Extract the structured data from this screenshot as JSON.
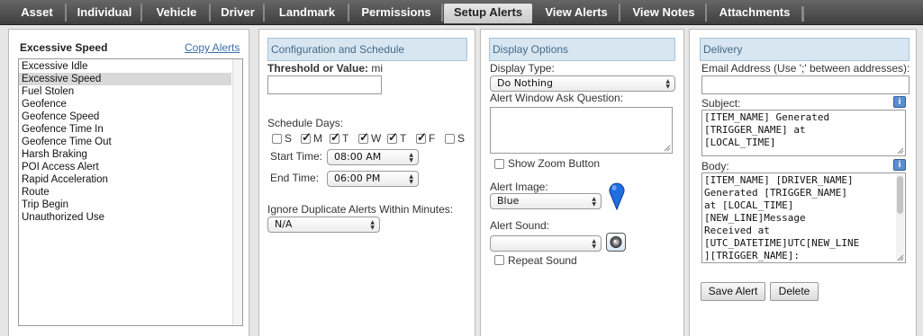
{
  "tabs": [
    {
      "label": "Asset"
    },
    {
      "label": "Individual"
    },
    {
      "label": "Vehicle"
    },
    {
      "label": "Driver"
    },
    {
      "label": "Landmark"
    },
    {
      "label": "Permissions"
    },
    {
      "label": "Setup Alerts"
    },
    {
      "label": "View Alerts"
    },
    {
      "label": "View Notes"
    },
    {
      "label": "Attachments"
    }
  ],
  "alerts_panel": {
    "title": "Excessive Speed",
    "copy_link": "Copy Alerts",
    "items": [
      "Excessive Idle",
      "Excessive Speed",
      "Fuel Stolen",
      "Geofence",
      "Geofence Speed",
      "Geofence Time In",
      "Geofence Time Out",
      "Harsh Braking",
      "POI Access Alert",
      "Rapid Acceleration",
      "Route",
      "Trip Begin",
      "Unauthorized Use"
    ],
    "selected_index": 1
  },
  "config": {
    "header": "Configuration and Schedule",
    "threshold_label": "Threshold or Value:",
    "threshold_unit": "mi",
    "threshold_value": "",
    "schedule_label": "Schedule Days:",
    "days": [
      {
        "letter": "S",
        "checked": false
      },
      {
        "letter": "M",
        "checked": true
      },
      {
        "letter": "T",
        "checked": true
      },
      {
        "letter": "W",
        "checked": true
      },
      {
        "letter": "T",
        "checked": true
      },
      {
        "letter": "F",
        "checked": true
      },
      {
        "letter": "S",
        "checked": false
      }
    ],
    "start_label": "Start Time:",
    "start_value": "08:00 AM",
    "end_label": "End Time:",
    "end_value": "06:00 PM",
    "ignore_label": "Ignore Duplicate Alerts Within Minutes:",
    "ignore_value": "N/A"
  },
  "display": {
    "header": "Display Options",
    "type_label": "Display Type:",
    "type_value": "Do Nothing",
    "ask_label": "Alert Window Ask Question:",
    "ask_value": "",
    "zoom_label": "Show Zoom Button",
    "zoom_checked": false,
    "image_label": "Alert Image:",
    "image_value": "Blue",
    "sound_label": "Alert Sound:",
    "sound_value": "",
    "repeat_label": "Repeat Sound",
    "repeat_checked": false,
    "pin_color": "#1f6fe0"
  },
  "delivery": {
    "header": "Delivery",
    "email_label": "Email Address (Use ';' between addresses):",
    "email_value": "",
    "subject_label": "Subject:",
    "subject_value": "[ITEM_NAME] Generated\n[TRIGGER_NAME] at\n[LOCAL_TIME]",
    "body_label": "Body:",
    "body_value": "[ITEM_NAME] [DRIVER_NAME]\nGenerated [TRIGGER_NAME]\nat [LOCAL_TIME]\n[NEW_LINE]Message\nReceived at\n[UTC_DATETIME]UTC[NEW_LINE\n][TRIGGER_NAME]:",
    "info_glyph": "i",
    "save_label": "Save Alert",
    "delete_label": "Delete"
  }
}
